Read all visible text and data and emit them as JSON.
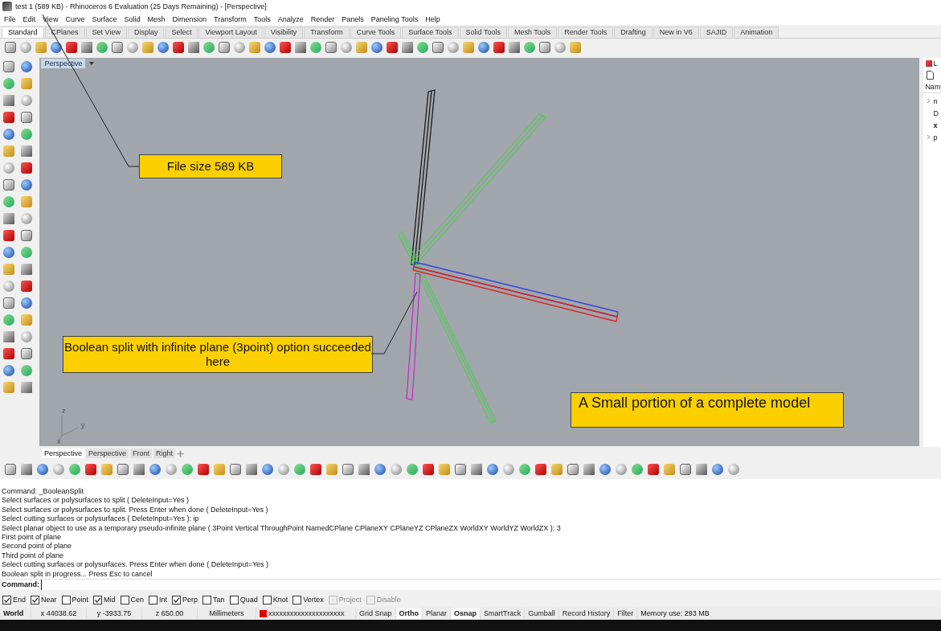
{
  "window": {
    "title": "test 1 (589 KB) - Rhinoceros 6 Evaluation (25 Days Remaining) - [Perspective]"
  },
  "menu": [
    "File",
    "Edit",
    "View",
    "Curve",
    "Surface",
    "Solid",
    "Mesh",
    "Dimension",
    "Transform",
    "Tools",
    "Analyze",
    "Render",
    "Panels",
    "Paneling Tools",
    "Help"
  ],
  "toolbar_tabs": [
    {
      "label": "Standard",
      "selected": true
    },
    {
      "label": "CPlanes",
      "selected": false
    },
    {
      "label": "Set View",
      "selected": false
    },
    {
      "label": "Display",
      "selected": false
    },
    {
      "label": "Select",
      "selected": false
    },
    {
      "label": "Viewport Layout",
      "selected": false
    },
    {
      "label": "Visibility",
      "selected": false
    },
    {
      "label": "Transform",
      "selected": false
    },
    {
      "label": "Curve Tools",
      "selected": false
    },
    {
      "label": "Surface Tools",
      "selected": false
    },
    {
      "label": "Solid Tools",
      "selected": false
    },
    {
      "label": "Mesh Tools",
      "selected": false
    },
    {
      "label": "Render Tools",
      "selected": false
    },
    {
      "label": "Drafting",
      "selected": false
    },
    {
      "label": "New in V6",
      "selected": false
    },
    {
      "label": "SAJID",
      "selected": false
    },
    {
      "label": "Animation",
      "selected": false
    }
  ],
  "viewport": {
    "title": "Perspective",
    "axes": [
      "z",
      "y",
      "x"
    ]
  },
  "annotations": [
    {
      "text": "File size 589 KB"
    },
    {
      "text": "Boolean split with infinite plane (3point) option succeeded here"
    },
    {
      "text": "A Small portion of a complete model"
    }
  ],
  "viewport_tabs": [
    {
      "label": "Perspective",
      "selected": true
    },
    {
      "label": "Perspective",
      "selected": false
    },
    {
      "label": "Front",
      "selected": false
    },
    {
      "label": "Right",
      "selected": false
    }
  ],
  "layers_panel": {
    "tab": "L",
    "header": "Nam",
    "rows": [
      {
        "text": "n",
        "expandable": true,
        "current": false
      },
      {
        "text": "D",
        "expandable": false,
        "current": false
      },
      {
        "text": "x",
        "expandable": false,
        "current": true
      },
      {
        "text": "p",
        "expandable": true,
        "current": false
      }
    ]
  },
  "command_history": [
    "Command: _BooleanSplit",
    "Select surfaces or polysurfaces to split ( DeleteInput=Yes )",
    "Select surfaces or polysurfaces to split. Press Enter when done ( DeleteInput=Yes )",
    "Select cutting surfaces or polysurfaces ( DeleteInput=Yes ): ip",
    "Select planar object to use as a temporary pseudo-infinite plane ( 3Point  Vertical  ThroughPoint  NamedCPlane  CPlaneXY  CPlaneYZ  CPlaneZX  WorldXY  WorldYZ  WorldZX ): 3",
    "First point of plane",
    "Second point of plane",
    "Third point of plane",
    "Select cutting surfaces or polysurfaces. Press Enter when done ( DeleteInput=Yes )",
    "Boolean split in progress... Press Esc to cancel"
  ],
  "command_prompt": {
    "label": "Command:"
  },
  "osnaps": [
    {
      "label": "End",
      "checked": true,
      "disabled": false
    },
    {
      "label": "Near",
      "checked": true,
      "disabled": false
    },
    {
      "label": "Point",
      "checked": false,
      "disabled": false
    },
    {
      "label": "Mid",
      "checked": true,
      "disabled": false
    },
    {
      "label": "Cen",
      "checked": false,
      "disabled": false
    },
    {
      "label": "Int",
      "checked": false,
      "disabled": false
    },
    {
      "label": "Perp",
      "checked": true,
      "disabled": false
    },
    {
      "label": "Tan",
      "checked": false,
      "disabled": false
    },
    {
      "label": "Quad",
      "checked": false,
      "disabled": false
    },
    {
      "label": "Knot",
      "checked": false,
      "disabled": false
    },
    {
      "label": "Vertex",
      "checked": false,
      "disabled": false
    },
    {
      "label": "Project",
      "checked": false,
      "disabled": true
    },
    {
      "label": "Disable",
      "checked": false,
      "disabled": true
    }
  ],
  "status_bar": {
    "cplane": "World",
    "x": "x 44038.62",
    "y": "y -3933.75",
    "z": "z 650.00",
    "units": "Millimeters",
    "layer": {
      "name": "xxxxxxxxxxxxxxxxxxxxx",
      "color": "#e00000"
    },
    "toggles": [
      {
        "label": "Grid Snap",
        "on": false
      },
      {
        "label": "Ortho",
        "on": true
      },
      {
        "label": "Planar",
        "on": false
      },
      {
        "label": "Osnap",
        "on": true
      },
      {
        "label": "SmartTrack",
        "on": false
      },
      {
        "label": "Gumball",
        "on": false
      },
      {
        "label": "Record History",
        "on": false
      },
      {
        "label": "Filter",
        "on": false
      }
    ],
    "memory": "Memory use: 293 MB"
  }
}
